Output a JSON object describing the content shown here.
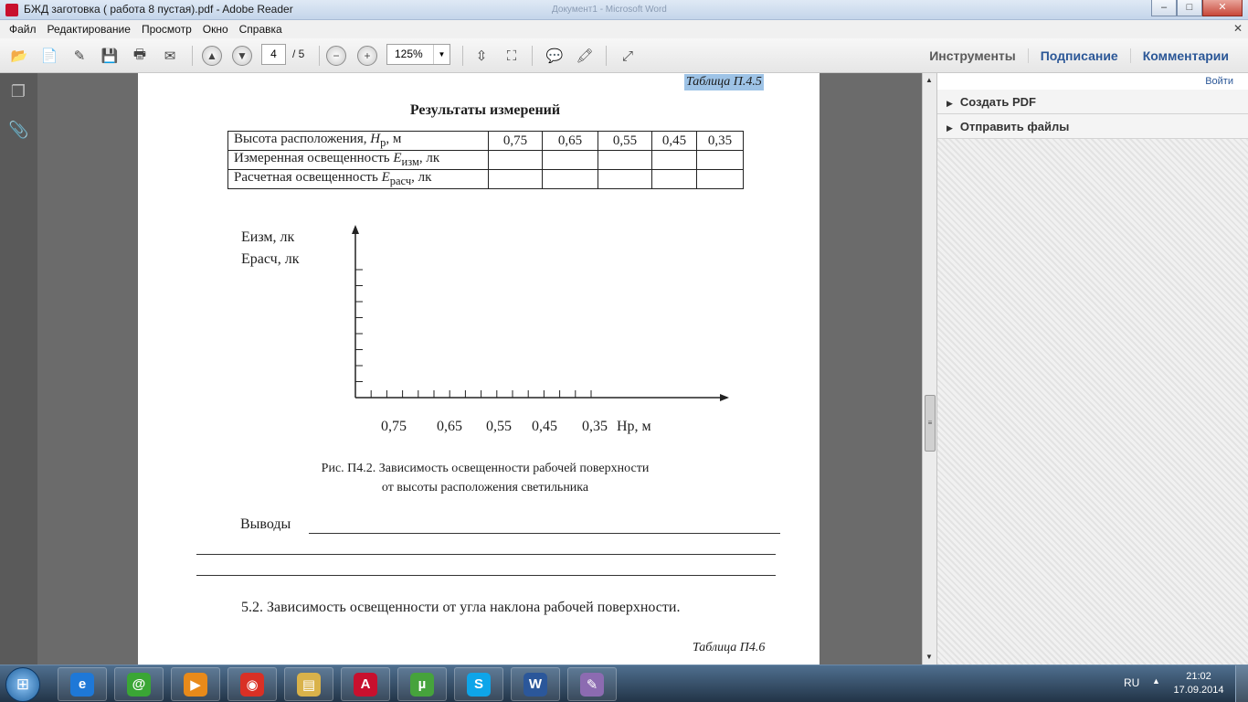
{
  "window": {
    "title": "БЖД заготовка ( работа 8 пустая).pdf - Adobe Reader",
    "background_title": "Документ1 - Microsoft Word",
    "controls": {
      "minimize": "–",
      "maximize": "□",
      "close": "✕"
    }
  },
  "menu": {
    "items": [
      "Файл",
      "Редактирование",
      "Просмотр",
      "Окно",
      "Справка"
    ],
    "close_glyph": "✕"
  },
  "toolbar": {
    "icons": [
      "open-icon",
      "create-pdf-icon",
      "edit-icon",
      "save-icon",
      "print-icon",
      "email-icon",
      "page-up-icon",
      "page-down-icon",
      "zoom-out-icon",
      "zoom-in-icon",
      "fit-width-icon",
      "fit-page-icon",
      "comment-icon",
      "highlight-icon",
      "fullscreen-icon"
    ],
    "page_current": "4",
    "page_total": "/ 5",
    "zoom": "125%",
    "links": [
      "Инструменты",
      "Подписание",
      "Комментарии"
    ]
  },
  "document": {
    "table_ref": "Таблица П.4.5",
    "table_title": "Результаты измерений",
    "table": {
      "rows": [
        {
          "label": "Высота расположения, Hр, м",
          "values": [
            "0,75",
            "0,65",
            "0,55",
            "0,45",
            "0,35"
          ]
        },
        {
          "label": "Измеренная освещенность Eизм, лк",
          "values": [
            "",
            "",
            "",
            "",
            ""
          ]
        },
        {
          "label": "Расчетная освещенность Eрасч, лк",
          "values": [
            "",
            "",
            "",
            "",
            ""
          ]
        }
      ]
    },
    "chart_data": {
      "type": "line",
      "ylabel_1": "Еизм, лк",
      "ylabel_2": "Ерасч, лк",
      "x_tick_labels": [
        "0,75",
        "0,65",
        "0,55",
        "0,45",
        "0,35"
      ],
      "x_axis_label": "Hр, м",
      "series": [],
      "grid": false
    },
    "caption_line1": "Рис. П4.2. Зависимость освещенности рабочей поверхности",
    "caption_line2": "от высоты расположения светильника",
    "conclusions_label": "Выводы",
    "section_heading": "5.2. Зависимость освещенности от угла наклона рабочей поверхности.",
    "next_table_ref": "Таблица П4.6"
  },
  "right_pane": {
    "signin": "Войти",
    "items": [
      "Создать PDF",
      "Отправить файлы"
    ]
  },
  "taskbar": {
    "apps": [
      {
        "name": "internet-explorer",
        "glyph": "e",
        "color": "#1e78d7"
      },
      {
        "name": "icq",
        "glyph": "@",
        "color": "#3aa635"
      },
      {
        "name": "media-player",
        "glyph": "▶",
        "color": "#e88a1a"
      },
      {
        "name": "chrome",
        "glyph": "◉",
        "color": "#d93025"
      },
      {
        "name": "explorer",
        "glyph": "▤",
        "color": "#d9b24a"
      },
      {
        "name": "adobe-reader",
        "glyph": "A",
        "color": "#c8102e"
      },
      {
        "name": "utorrent",
        "glyph": "µ",
        "color": "#46a33c"
      },
      {
        "name": "skype",
        "glyph": "S",
        "color": "#0ea5e9"
      },
      {
        "name": "word",
        "glyph": "W",
        "color": "#2b579a"
      },
      {
        "name": "paint",
        "glyph": "✎",
        "color": "#8c6bb1"
      }
    ],
    "lang": "RU",
    "tray_arrow": "▲",
    "time": "21:02",
    "date": "17.09.2014"
  }
}
